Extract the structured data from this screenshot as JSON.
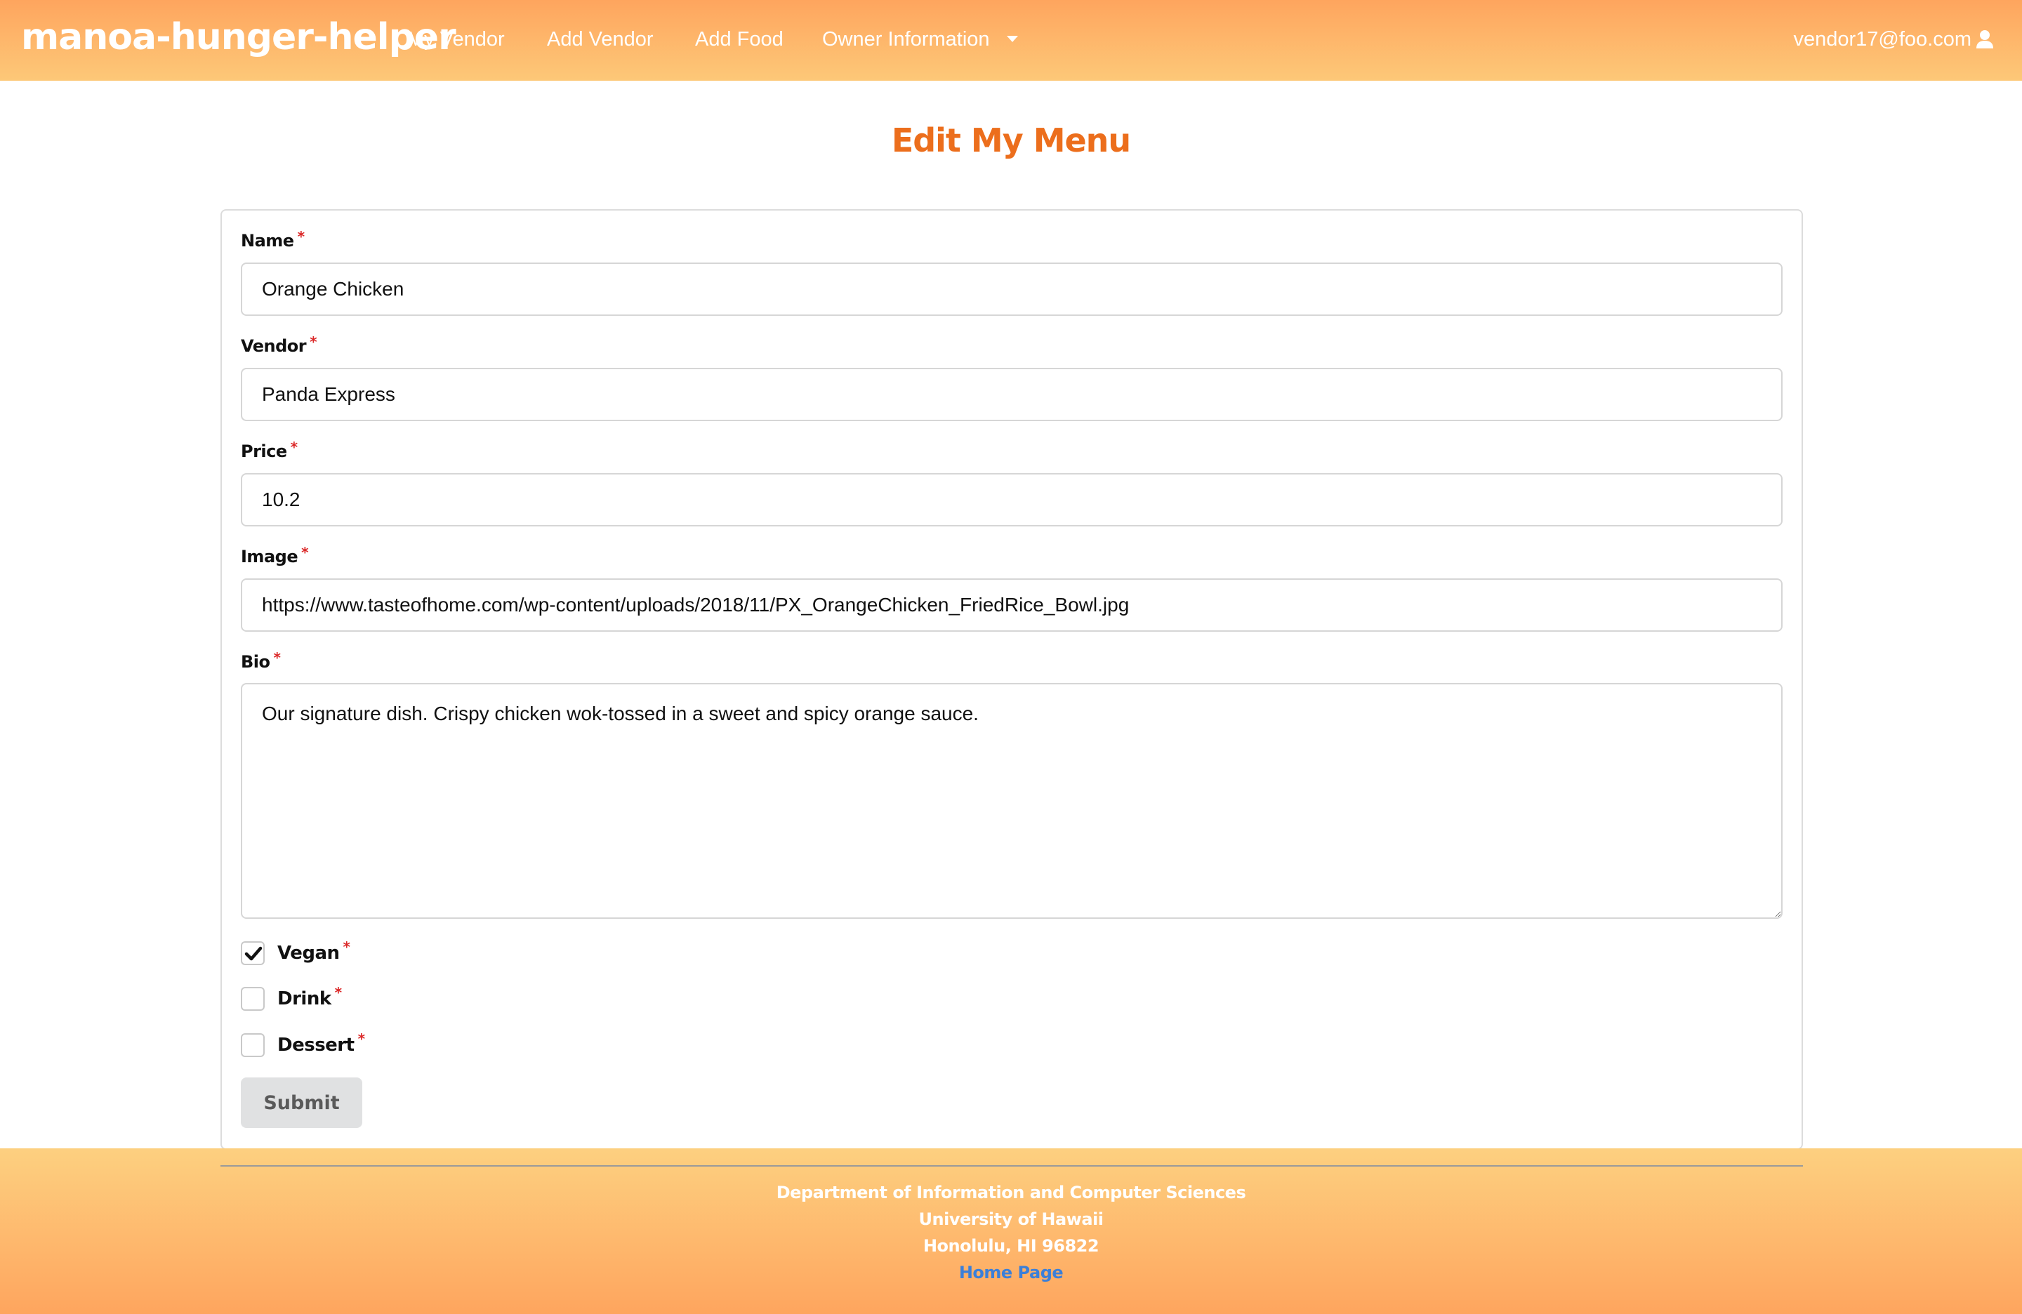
{
  "navbar": {
    "brand": "manoa-hunger-helper",
    "links": [
      "My Vendor",
      "Add Vendor",
      "Add Food",
      "Owner Information"
    ],
    "user_email": "vendor17@foo.com",
    "user_icon": "user-icon",
    "dropdown_icon": "caret-down-icon",
    "background_colors": [
      "#fea55e",
      "#fdc878"
    ]
  },
  "page": {
    "title": "Edit My Menu",
    "title_color": "#ec6e1c"
  },
  "form": {
    "required_marker": "*",
    "name": {
      "label": "Name",
      "value": "Orange Chicken"
    },
    "vendor": {
      "label": "Vendor",
      "value": "Panda Express"
    },
    "price": {
      "label": "Price",
      "value": "10.2"
    },
    "image": {
      "label": "Image",
      "value": "https://www.tasteofhome.com/wp-content/uploads/2018/11/PX_OrangeChicken_FriedRice_Bowl.jpg"
    },
    "bio": {
      "label": "Bio",
      "value": "Our signature dish. Crispy chicken wok-tossed in a sweet and spicy orange sauce."
    },
    "vegan": {
      "label": "Vegan",
      "checked": true
    },
    "drink": {
      "label": "Drink",
      "checked": false
    },
    "dessert": {
      "label": "Dessert",
      "checked": false
    },
    "submit_label": "Submit"
  },
  "footer": {
    "line1": "Department of Information and Computer Sciences",
    "line2": "University of Hawaii",
    "line3": "Honolulu, HI 96822",
    "link": "Home Page",
    "link_color": "#3b7fd9"
  }
}
